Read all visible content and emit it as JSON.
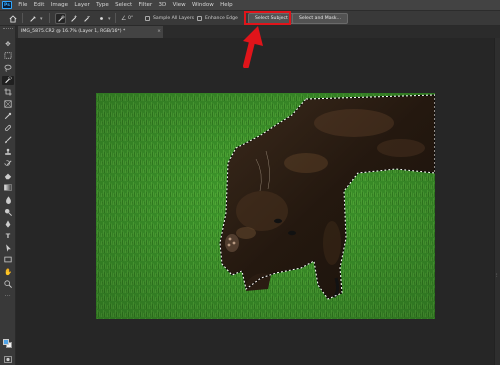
{
  "app": {
    "logo": "Ps"
  },
  "menu": [
    "File",
    "Edit",
    "Image",
    "Layer",
    "Type",
    "Select",
    "Filter",
    "3D",
    "View",
    "Window",
    "Help"
  ],
  "options": {
    "angle_value": "0°",
    "sample_all_layers": "Sample All Layers",
    "enhance_edge": "Enhance Edge",
    "select_subject": "Select Subject",
    "select_and_mask": "Select and Mask..."
  },
  "document": {
    "tab_title": "IMG_5875.CR2 @ 16.7% (Layer 1, RGB/16*) *",
    "close_glyph": "×"
  },
  "tools": [
    "move-tool",
    "artboard-tool",
    "lasso-tool",
    "quick-selection-tool",
    "crop-tool",
    "frame-tool",
    "eyedropper-tool",
    "spot-healing-tool",
    "brush-tool",
    "clone-stamp-tool",
    "history-brush-tool",
    "eraser-tool",
    "gradient-tool",
    "blur-tool",
    "dodge-tool",
    "pen-tool",
    "type-tool",
    "path-selection-tool",
    "rectangle-tool",
    "hand-tool",
    "zoom-tool",
    "more-tools"
  ],
  "colors": {
    "foreground": "#4fa3e6",
    "background": "#f2f2f2",
    "highlight": "#e0141a",
    "grass": "#3f9b2c",
    "cat_fur": "#2a1d14"
  }
}
